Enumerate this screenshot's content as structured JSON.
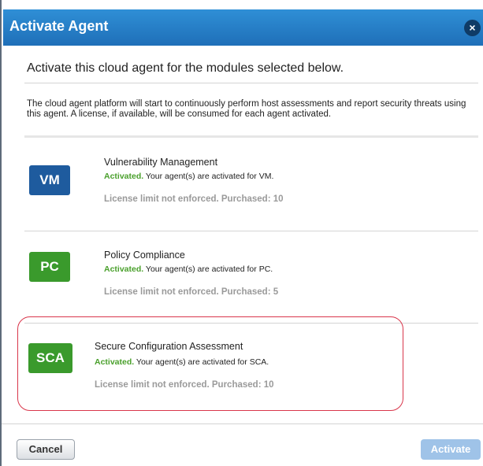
{
  "dialog": {
    "title": "Activate Agent",
    "close_label": "×",
    "heading": "Activate this cloud agent for the modules selected below.",
    "description": "The cloud agent platform will start to continuously perform host assessments and report security threats using this agent. A license, if available, will be consumed for each agent activated."
  },
  "modules": [
    {
      "badge": "VM",
      "name": "Vulnerability Management",
      "status_word": "Activated.",
      "status_text": " Your agent(s) are activated for VM.",
      "license": "License limit not enforced. Purchased: 10",
      "badge_color": "#1e5b9e"
    },
    {
      "badge": "PC",
      "name": "Policy Compliance",
      "status_word": "Activated.",
      "status_text": " Your agent(s) are activated for PC.",
      "license": "License limit not enforced. Purchased: 5",
      "badge_color": "#3a9a2c"
    },
    {
      "badge": "SCA",
      "name": "Secure Configuration Assessment",
      "status_word": "Activated.",
      "status_text": " Your agent(s) are activated for SCA.",
      "license": "License limit not enforced. Purchased: 10",
      "badge_color": "#3a9a2c"
    }
  ],
  "footer": {
    "cancel_label": "Cancel",
    "activate_label": "Activate"
  },
  "colors": {
    "titlebar": "#1f6fb8",
    "activated_text": "#4aa02c",
    "highlight_border": "#d9364b",
    "activate_button_disabled": "#9fc3e8"
  },
  "icons": {
    "close": "close-icon"
  }
}
